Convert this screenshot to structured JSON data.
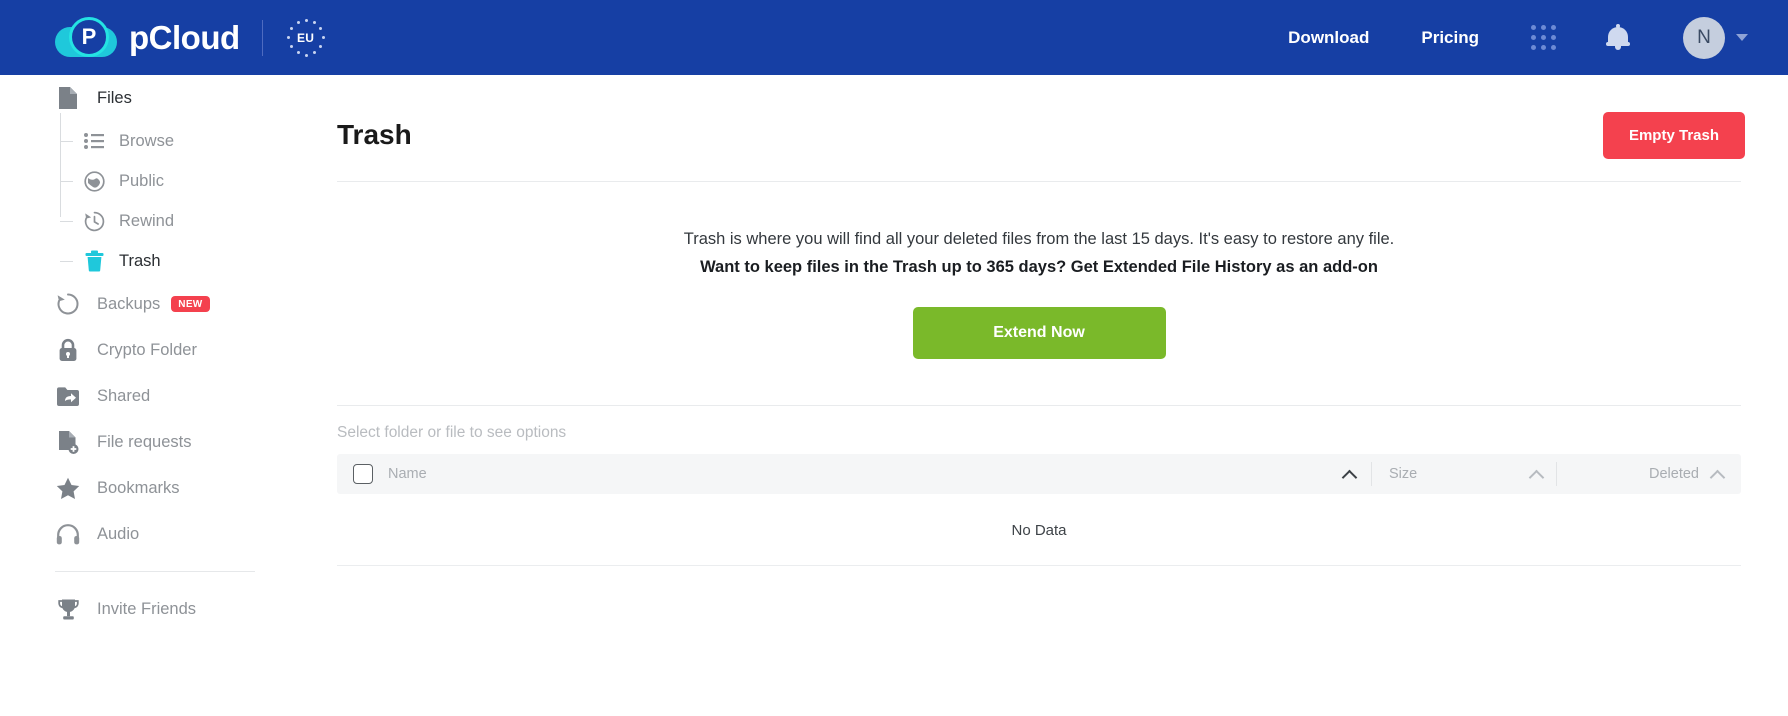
{
  "topbar": {
    "brand_name": "pCloud",
    "eu_label": "EU",
    "links": [
      {
        "label": "Download",
        "name": "nav-download"
      },
      {
        "label": "Pricing",
        "name": "nav-pricing"
      }
    ],
    "apps_icon": "apps-grid-icon",
    "bell_icon": "notification-bell-icon",
    "avatar_initial": "N",
    "caret_icon": "chevron-down-icon",
    "background_color": "#163fa4"
  },
  "sidebar": {
    "root": {
      "label": "Files",
      "icon": "file-icon"
    },
    "sub_items": [
      {
        "label": "Browse",
        "icon": "list-icon"
      },
      {
        "label": "Public",
        "icon": "globe-icon"
      },
      {
        "label": "Rewind",
        "icon": "clock-rewind-icon"
      },
      {
        "label": "Trash",
        "icon": "trash-icon",
        "active": true
      }
    ],
    "items": [
      {
        "label": "Backups",
        "icon": "backup-rewind-icon",
        "badge": "NEW"
      },
      {
        "label": "Crypto Folder",
        "icon": "lock-icon"
      },
      {
        "label": "Shared",
        "icon": "shared-folder-icon"
      },
      {
        "label": "File requests",
        "icon": "file-plus-icon"
      },
      {
        "label": "Bookmarks",
        "icon": "star-icon"
      },
      {
        "label": "Audio",
        "icon": "headphones-icon"
      }
    ],
    "footer_items": [
      {
        "label": "Invite Friends",
        "icon": "trophy-icon"
      }
    ],
    "badge_color": "#f4414e",
    "active_color": "#1fc8db"
  },
  "main": {
    "page_title": "Trash",
    "empty_trash_label": "Empty Trash",
    "empty_trash_color": "#f4414e",
    "promo": {
      "line1": "Trash is where you will find all your deleted files from the last 15 days. It's easy to restore any file.",
      "line2": "Want to keep files in the Trash up to 365 days? Get Extended File History as an add-on",
      "cta_label": "Extend Now",
      "cta_color": "#7ab92a"
    },
    "select_hint": "Select folder or file to see options",
    "table": {
      "columns": [
        {
          "label": "Name",
          "sort_icon": "chevron-up-icon",
          "sorted": true
        },
        {
          "label": "Size",
          "sort_icon": "chevron-up-icon",
          "sorted": false
        },
        {
          "label": "Deleted",
          "sort_icon": "chevron-up-icon",
          "sorted": false
        }
      ],
      "select_all_checkbox": "unchecked",
      "rows": [],
      "empty_message": "No Data"
    }
  }
}
